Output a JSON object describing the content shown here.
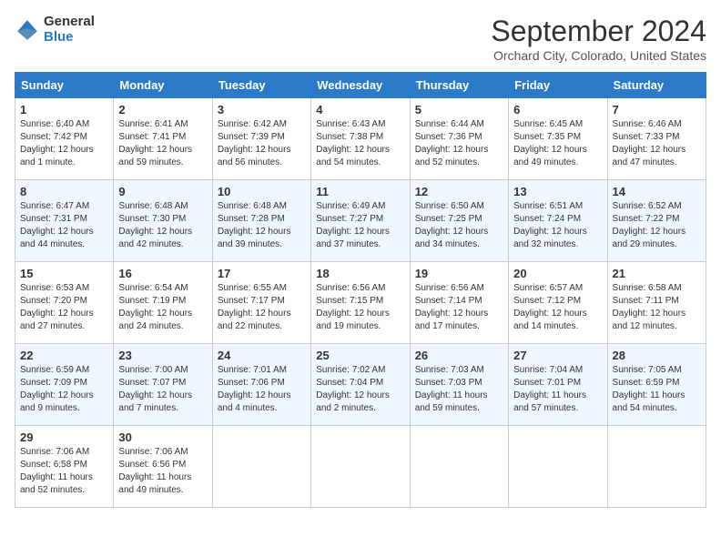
{
  "header": {
    "logo_line1": "General",
    "logo_line2": "Blue",
    "month": "September 2024",
    "location": "Orchard City, Colorado, United States"
  },
  "columns": [
    "Sunday",
    "Monday",
    "Tuesday",
    "Wednesday",
    "Thursday",
    "Friday",
    "Saturday"
  ],
  "weeks": [
    [
      {
        "day": 1,
        "sunrise": "6:40 AM",
        "sunset": "7:42 PM",
        "daylight": "12 hours and 1 minute."
      },
      {
        "day": 2,
        "sunrise": "6:41 AM",
        "sunset": "7:41 PM",
        "daylight": "12 hours and 59 minutes."
      },
      {
        "day": 3,
        "sunrise": "6:42 AM",
        "sunset": "7:39 PM",
        "daylight": "12 hours and 56 minutes."
      },
      {
        "day": 4,
        "sunrise": "6:43 AM",
        "sunset": "7:38 PM",
        "daylight": "12 hours and 54 minutes."
      },
      {
        "day": 5,
        "sunrise": "6:44 AM",
        "sunset": "7:36 PM",
        "daylight": "12 hours and 52 minutes."
      },
      {
        "day": 6,
        "sunrise": "6:45 AM",
        "sunset": "7:35 PM",
        "daylight": "12 hours and 49 minutes."
      },
      {
        "day": 7,
        "sunrise": "6:46 AM",
        "sunset": "7:33 PM",
        "daylight": "12 hours and 47 minutes."
      }
    ],
    [
      {
        "day": 8,
        "sunrise": "6:47 AM",
        "sunset": "7:31 PM",
        "daylight": "12 hours and 44 minutes."
      },
      {
        "day": 9,
        "sunrise": "6:48 AM",
        "sunset": "7:30 PM",
        "daylight": "12 hours and 42 minutes."
      },
      {
        "day": 10,
        "sunrise": "6:48 AM",
        "sunset": "7:28 PM",
        "daylight": "12 hours and 39 minutes."
      },
      {
        "day": 11,
        "sunrise": "6:49 AM",
        "sunset": "7:27 PM",
        "daylight": "12 hours and 37 minutes."
      },
      {
        "day": 12,
        "sunrise": "6:50 AM",
        "sunset": "7:25 PM",
        "daylight": "12 hours and 34 minutes."
      },
      {
        "day": 13,
        "sunrise": "6:51 AM",
        "sunset": "7:24 PM",
        "daylight": "12 hours and 32 minutes."
      },
      {
        "day": 14,
        "sunrise": "6:52 AM",
        "sunset": "7:22 PM",
        "daylight": "12 hours and 29 minutes."
      }
    ],
    [
      {
        "day": 15,
        "sunrise": "6:53 AM",
        "sunset": "7:20 PM",
        "daylight": "12 hours and 27 minutes."
      },
      {
        "day": 16,
        "sunrise": "6:54 AM",
        "sunset": "7:19 PM",
        "daylight": "12 hours and 24 minutes."
      },
      {
        "day": 17,
        "sunrise": "6:55 AM",
        "sunset": "7:17 PM",
        "daylight": "12 hours and 22 minutes."
      },
      {
        "day": 18,
        "sunrise": "6:56 AM",
        "sunset": "7:15 PM",
        "daylight": "12 hours and 19 minutes."
      },
      {
        "day": 19,
        "sunrise": "6:56 AM",
        "sunset": "7:14 PM",
        "daylight": "12 hours and 17 minutes."
      },
      {
        "day": 20,
        "sunrise": "6:57 AM",
        "sunset": "7:12 PM",
        "daylight": "12 hours and 14 minutes."
      },
      {
        "day": 21,
        "sunrise": "6:58 AM",
        "sunset": "7:11 PM",
        "daylight": "12 hours and 12 minutes."
      }
    ],
    [
      {
        "day": 22,
        "sunrise": "6:59 AM",
        "sunset": "7:09 PM",
        "daylight": "12 hours and 9 minutes."
      },
      {
        "day": 23,
        "sunrise": "7:00 AM",
        "sunset": "7:07 PM",
        "daylight": "12 hours and 7 minutes."
      },
      {
        "day": 24,
        "sunrise": "7:01 AM",
        "sunset": "7:06 PM",
        "daylight": "12 hours and 4 minutes."
      },
      {
        "day": 25,
        "sunrise": "7:02 AM",
        "sunset": "7:04 PM",
        "daylight": "12 hours and 2 minutes."
      },
      {
        "day": 26,
        "sunrise": "7:03 AM",
        "sunset": "7:03 PM",
        "daylight": "11 hours and 59 minutes."
      },
      {
        "day": 27,
        "sunrise": "7:04 AM",
        "sunset": "7:01 PM",
        "daylight": "11 hours and 57 minutes."
      },
      {
        "day": 28,
        "sunrise": "7:05 AM",
        "sunset": "6:59 PM",
        "daylight": "11 hours and 54 minutes."
      }
    ],
    [
      {
        "day": 29,
        "sunrise": "7:06 AM",
        "sunset": "6:58 PM",
        "daylight": "11 hours and 52 minutes."
      },
      {
        "day": 30,
        "sunrise": "7:06 AM",
        "sunset": "6:56 PM",
        "daylight": "11 hours and 49 minutes."
      },
      null,
      null,
      null,
      null,
      null
    ]
  ]
}
